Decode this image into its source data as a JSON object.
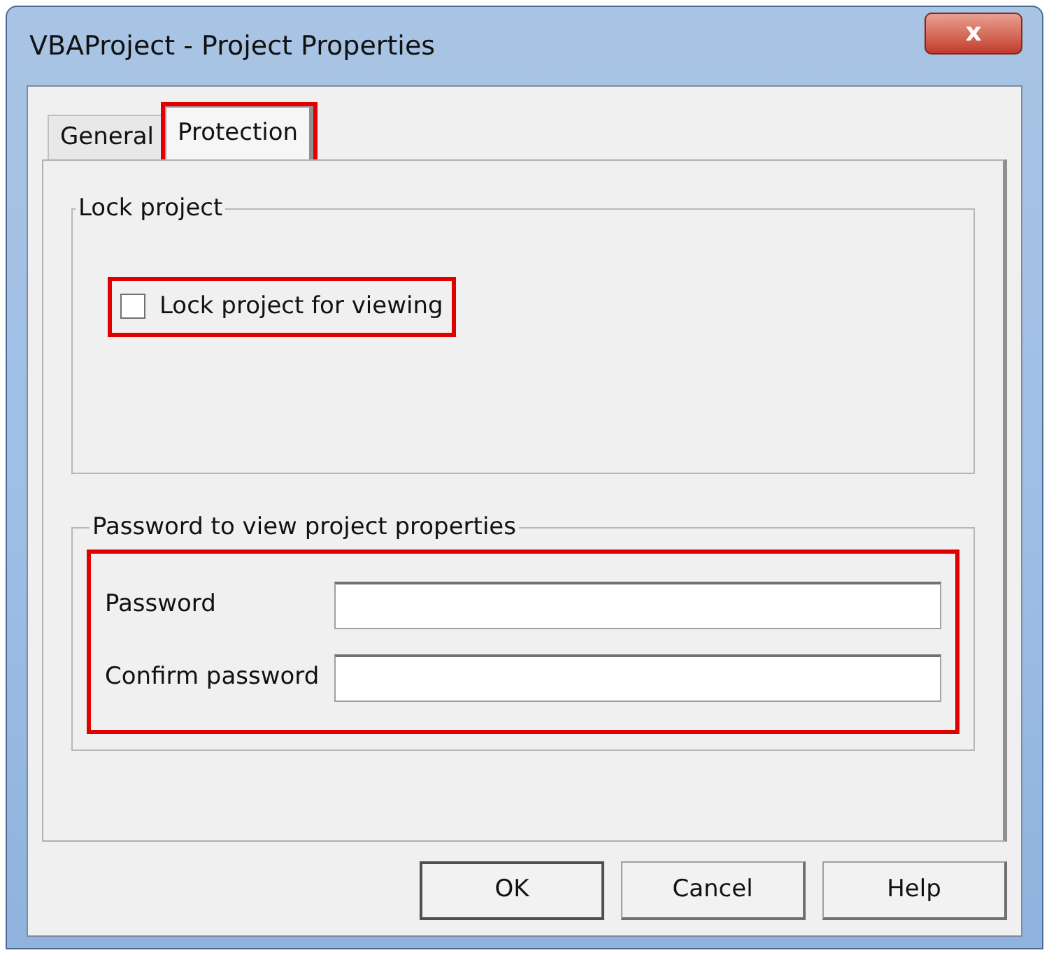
{
  "window": {
    "title": "VBAProject - Project Properties",
    "close": "x"
  },
  "tabs": [
    {
      "label": "General",
      "selected": false,
      "highlighted": false
    },
    {
      "label": "Protection",
      "selected": true,
      "highlighted": true
    }
  ],
  "lock_group": {
    "title": "Lock project",
    "checkbox": {
      "label": "Lock project for viewing",
      "checked": false,
      "highlighted": true
    }
  },
  "password_group": {
    "title": "Password to view project properties",
    "highlighted": true,
    "fields": [
      {
        "label": "Password"
      },
      {
        "label": "Confirm password"
      }
    ]
  },
  "buttons": [
    {
      "label": "OK",
      "default": true
    },
    {
      "label": "Cancel",
      "default": false
    },
    {
      "label": "Help",
      "default": false
    }
  ]
}
